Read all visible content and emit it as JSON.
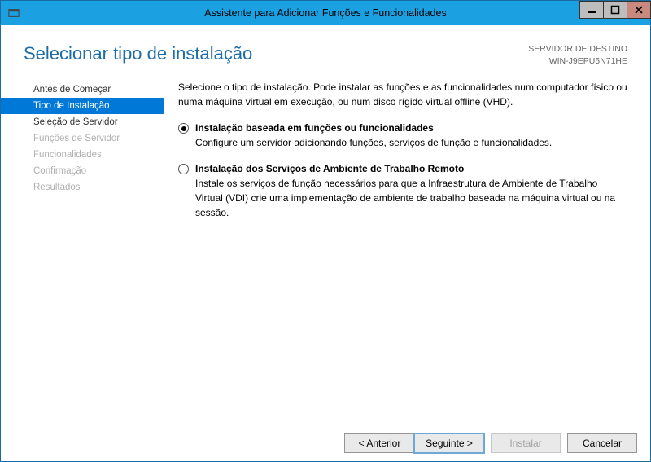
{
  "window": {
    "title": "Assistente para Adicionar Funções e Funcionalidades"
  },
  "header": {
    "page_title": "Selecionar tipo de instalação",
    "destination_label": "SERVIDOR DE DESTINO",
    "destination_value": "WIN-J9EPU5N71HE"
  },
  "sidebar": {
    "items": [
      {
        "label": "Antes de Começar",
        "state": "enabled"
      },
      {
        "label": "Tipo de Instalação",
        "state": "selected"
      },
      {
        "label": "Seleção de Servidor",
        "state": "enabled"
      },
      {
        "label": "Funções de Servidor",
        "state": "disabled"
      },
      {
        "label": "Funcionalidades",
        "state": "disabled"
      },
      {
        "label": "Confirmação",
        "state": "disabled"
      },
      {
        "label": "Resultados",
        "state": "disabled"
      }
    ]
  },
  "main": {
    "intro": "Selecione o tipo de instalação. Pode instalar as funções e as funcionalidades num computador físico ou numa máquina virtual em execução, ou num disco rígido virtual offline (VHD).",
    "options": [
      {
        "title": "Instalação baseada em funções ou funcionalidades",
        "desc": "Configure um servidor adicionando funções, serviços de função e funcionalidades.",
        "checked": true
      },
      {
        "title": "Instalação dos Serviços de Ambiente de Trabalho Remoto",
        "desc": "Instale os serviços de função necessários para que a Infraestrutura de Ambiente de Trabalho Virtual (VDI) crie uma implementação de ambiente de trabalho baseada na máquina virtual ou na sessão.",
        "checked": false
      }
    ]
  },
  "footer": {
    "previous": "< Anterior",
    "next": "Seguinte >",
    "install": "Instalar",
    "cancel": "Cancelar"
  }
}
